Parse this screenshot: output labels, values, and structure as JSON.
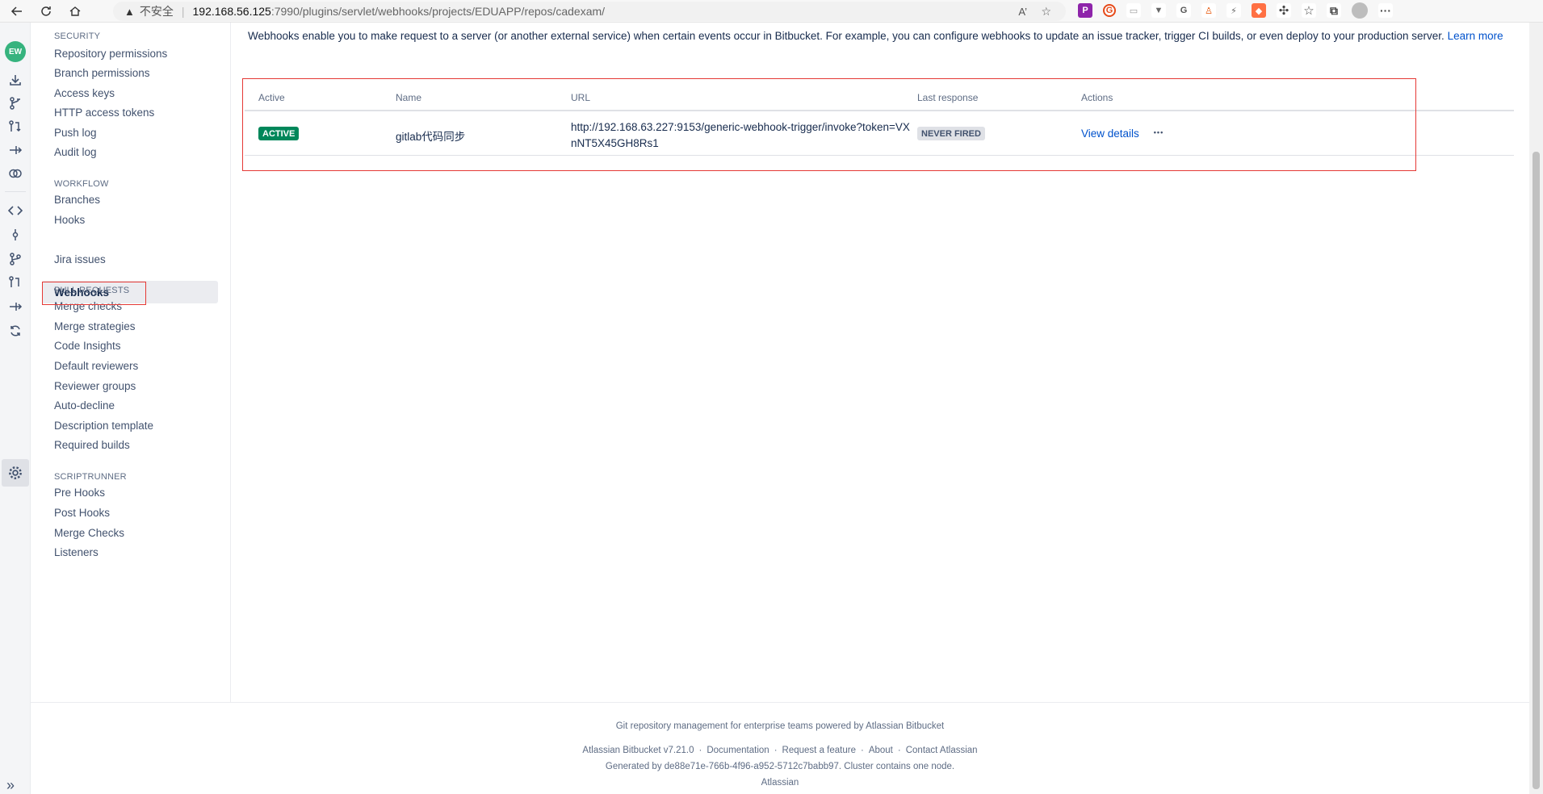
{
  "browser": {
    "insecure_label": "不安全",
    "url_host": "192.168.56.125",
    "url_rest": ":7990/plugins/servlet/webhooks/projects/EDUAPP/repos/cadexam/"
  },
  "sidebar": {
    "security": {
      "title": "SECURITY",
      "items": [
        "Repository permissions",
        "Branch permissions",
        "Access keys",
        "HTTP access tokens",
        "Push log",
        "Audit log"
      ]
    },
    "workflow": {
      "title": "WORKFLOW",
      "items": [
        "Branches",
        "Hooks",
        "Webhooks",
        "Jira issues"
      ]
    },
    "pull_requests": {
      "title": "PULL REQUESTS",
      "items": [
        "Merge checks",
        "Merge strategies",
        "Code Insights",
        "Default reviewers",
        "Reviewer groups",
        "Auto-decline",
        "Description template",
        "Required builds"
      ]
    },
    "scriptrunner": {
      "title": "SCRIPTRUNNER",
      "items": [
        "Pre Hooks",
        "Post Hooks",
        "Merge Checks",
        "Listeners"
      ]
    },
    "active_item": "Webhooks"
  },
  "main": {
    "intro_text": "Webhooks enable you to make request to a server (or another external service) when certain events occur in Bitbucket. For example, you can configure webhooks to update an issue tracker, trigger CI builds, or even deploy to your production server.",
    "learn_more": "Learn more",
    "table": {
      "headers": {
        "active": "Active",
        "name": "Name",
        "url": "URL",
        "last_response": "Last response",
        "actions": "Actions"
      },
      "row": {
        "status": "ACTIVE",
        "name": "gitlab代码同步",
        "url": "http://192.168.63.227:9153/generic-webhook-trigger/invoke?token=VXnNT5X45GH8Rs1",
        "last_response": "NEVER FIRED",
        "view_details": "View details",
        "more": "•••"
      }
    }
  },
  "footer": {
    "tagline": "Git repository management for enterprise teams powered by Atlassian Bitbucket",
    "links": [
      "Atlassian Bitbucket v7.21.0",
      "Documentation",
      "Request a feature",
      "About",
      "Contact Atlassian"
    ],
    "generated": "Generated by de88e71e-766b-4f96-a952-5712c7babb97. Cluster contains one node.",
    "brand": "Atlassian"
  },
  "colors": {
    "active_lozenge": "#00875a",
    "link": "#0052cc",
    "highlight_box": "#e53935"
  }
}
